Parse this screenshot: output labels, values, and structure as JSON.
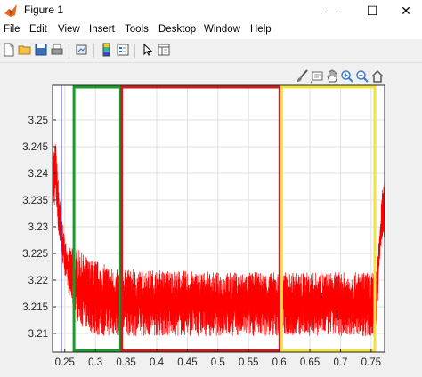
{
  "window": {
    "title": "Figure 1",
    "minimize": "—",
    "maximize": "☐",
    "close": "✕"
  },
  "menu": [
    "File",
    "Edit",
    "View",
    "Insert",
    "Tools",
    "Desktop",
    "Window",
    "Help"
  ],
  "toolbar_icons": [
    "new-figure-icon",
    "open-file-icon",
    "save-icon",
    "print-icon",
    "link-plot-icon",
    "insert-colorbar-icon",
    "insert-legend-icon",
    "edit-plot-icon",
    "property-inspector-icon"
  ],
  "axes_toolbar_icons": [
    "brush-icon",
    "data-tips-icon",
    "pan-icon",
    "zoom-in-icon",
    "zoom-out-icon",
    "home-icon"
  ],
  "colors": {
    "signal": "#ff0000",
    "green_box": "#1a9a2a",
    "red_box": "#c81e1e",
    "yellow_box": "#f2e33a",
    "axis": "#262626",
    "grid": "#dfdfdf"
  },
  "chart_data": {
    "type": "line",
    "title": "",
    "xlabel": "",
    "ylabel": "",
    "xlim": [
      0.23,
      0.772
    ],
    "ylim": [
      3.2065,
      3.2565
    ],
    "xticks": [
      "0.25",
      "0.3",
      "0.35",
      "0.4",
      "0.45",
      "0.5",
      "0.55",
      "0.6",
      "0.65",
      "0.7",
      "0.75"
    ],
    "yticks": [
      "3.21",
      "3.215",
      "3.22",
      "3.225",
      "3.23",
      "3.235",
      "3.24",
      "3.245",
      "3.25"
    ],
    "grid": true,
    "series": [
      {
        "color": "#ff0000",
        "x": [
          0.23,
          0.235,
          0.24,
          0.245,
          0.25,
          0.255,
          0.26,
          0.265,
          0.27,
          0.28,
          0.29,
          0.3,
          0.31,
          0.32,
          0.33,
          0.34,
          0.35,
          0.4,
          0.5,
          0.6,
          0.7,
          0.75,
          0.758,
          0.763,
          0.768,
          0.772
        ],
        "upper": [
          3.244,
          3.246,
          3.238,
          3.232,
          3.228,
          3.226,
          3.226,
          3.226,
          3.226,
          3.225,
          3.224,
          3.224,
          3.223,
          3.223,
          3.222,
          3.222,
          3.222,
          3.222,
          3.2215,
          3.2215,
          3.2215,
          3.2215,
          3.2215,
          3.228,
          3.237,
          3.2385
        ],
        "lower": [
          3.232,
          3.235,
          3.228,
          3.224,
          3.221,
          3.218,
          3.216,
          3.2135,
          3.2125,
          3.211,
          3.2105,
          3.2095,
          3.2095,
          3.2095,
          3.2095,
          3.2095,
          3.2095,
          3.2095,
          3.2095,
          3.2095,
          3.2095,
          3.2095,
          3.2095,
          3.2215,
          3.228,
          3.228
        ]
      }
    ],
    "annotations": [
      {
        "label": "green-region",
        "color": "#1a9a2a",
        "x": [
          0.265,
          0.341
        ],
        "y": [
          3.2065,
          3.2565
        ]
      },
      {
        "label": "red-region",
        "color": "#c81e1e",
        "x": [
          0.343,
          0.601
        ],
        "y": [
          3.2065,
          3.2565
        ]
      },
      {
        "label": "yellow-region",
        "color": "#f2e33a",
        "x": [
          0.604,
          0.756
        ],
        "y": [
          3.2065,
          3.2565
        ]
      }
    ]
  }
}
